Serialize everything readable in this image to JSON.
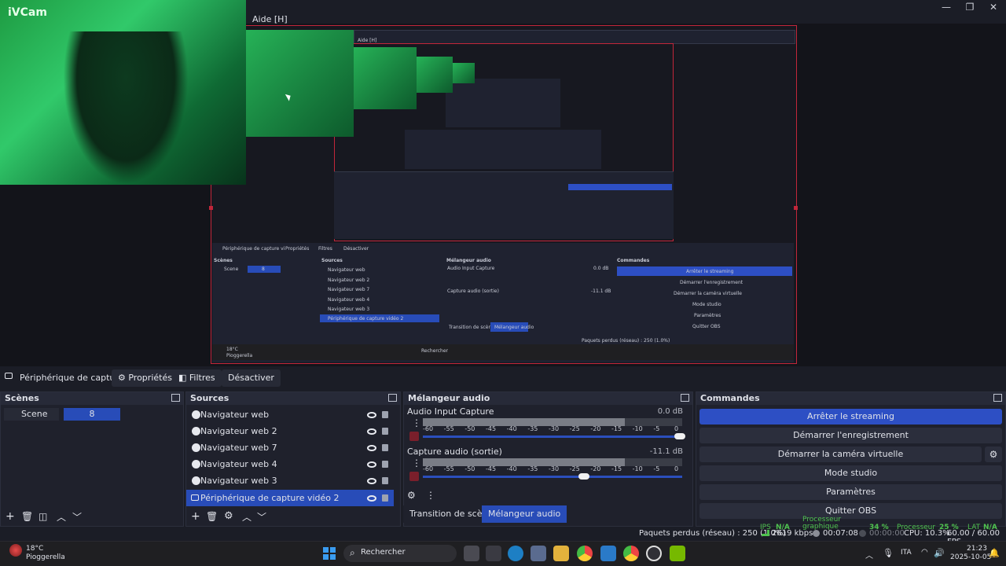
{
  "window": {
    "menu_help": "Aide [H]",
    "controls": [
      "—",
      "❐",
      "✕"
    ]
  },
  "camera": {
    "label": "iVCam"
  },
  "inner": {
    "menu_help": "Aide [H]",
    "source_label": "Périphérique de capture vi",
    "props": "Propriétés",
    "filters": "Filtres",
    "deactivate": "Désactiver",
    "scenes_title": "Scènes",
    "scene": "Scene",
    "scene_val": "8",
    "sources_title": "Sources",
    "sources": [
      "Navigateur web",
      "Navigateur web 2",
      "Navigateur web 7",
      "Navigateur web 4",
      "Navigateur web 3",
      "Périphérique de capture vidéo 2"
    ],
    "mixer_title": "Mélangeur audio",
    "mixer_a": "Audio Input Capture",
    "mixer_a_db": "0.0 dB",
    "mixer_b": "Capture audio (sortie)",
    "mixer_b_db": "-11.1 dB",
    "tab_transition": "Transition de scènes",
    "tab_mixer": "Mélangeur audio",
    "cmd_title": "Commandes",
    "commands": [
      "Arrêter le streaming",
      "Démarrer l'enregistrement",
      "Démarrer la caméra virtuelle",
      "Mode studio",
      "Paramètres",
      "Quitter OBS"
    ],
    "status_lost": "Paquets perdus (réseau) : 250 (1.0%)",
    "weather_temp": "18°C",
    "weather_place": "Pioggerella",
    "search": "Rechercher"
  },
  "source_toolbar": {
    "selected_source": "Périphérique de capture vi",
    "properties": "Propriétés",
    "filters": "Filtres",
    "deactivate": "Désactiver"
  },
  "scenes": {
    "title": "Scènes",
    "items": [
      {
        "label": "Scene",
        "count": "8"
      }
    ]
  },
  "sources": {
    "title": "Sources",
    "items": [
      {
        "label": "Navigateur web"
      },
      {
        "label": "Navigateur web 2"
      },
      {
        "label": "Navigateur web 7"
      },
      {
        "label": "Navigateur web 4"
      },
      {
        "label": "Navigateur web 3"
      },
      {
        "label": "Périphérique de capture vidéo 2"
      }
    ]
  },
  "mixer": {
    "title": "Mélangeur audio",
    "channels": [
      {
        "name": "Audio Input Capture",
        "db": "0.0 dB",
        "level": 0.78,
        "fader": 1.0
      },
      {
        "name": "Capture audio (sortie)",
        "db": "-11.1 dB",
        "level": 0.78,
        "fader": 0.63
      }
    ],
    "ticks": [
      "-60",
      "-55",
      "-50",
      "-45",
      "-40",
      "-35",
      "-30",
      "-25",
      "-20",
      "-15",
      "-10",
      "-5",
      "0"
    ],
    "tab_transition": "Transition de scènes",
    "tab_mixer": "Mélangeur audio"
  },
  "commands": {
    "title": "Commandes",
    "stop_streaming": "Arrêter le streaming",
    "start_recording": "Démarrer l'enregistrement",
    "start_virtualcam": "Démarrer la caméra virtuelle",
    "studio_mode": "Mode studio",
    "settings": "Paramètres",
    "quit": "Quitter OBS"
  },
  "status": {
    "ips": "IPS",
    "na1": "N/A",
    "proc_graph": "Processeur graphique",
    "pct1": "34 %",
    "proc": "Processeur",
    "pct2": "25 %",
    "lat": "LAT",
    "na2": "N/A",
    "lost_packets": "Paquets perdus (réseau) : 250 (1.0%)",
    "bitrate": "2619 kbps",
    "stream_time": "00:07:08",
    "rec_time": "00:00:00",
    "cpu": "CPU: 10.3%",
    "fps": "60.00 / 60.00 FPS"
  },
  "taskbar": {
    "weather_temp": "18°C",
    "weather_desc": "Pioggerella",
    "search_label": "Rechercher",
    "lang": "ITA",
    "time": "21:23",
    "date": "2025-10-05"
  },
  "colors": {
    "accent": "#284cb8",
    "accent_button": "#2d4fc4",
    "canvas_border": "#c2263a",
    "status_green": "#4fc24f"
  }
}
